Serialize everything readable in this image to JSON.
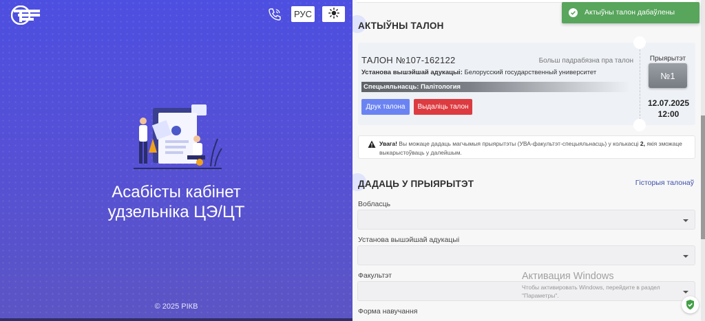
{
  "left_panel": {
    "title_line1": "Асабісты кабінет",
    "title_line2": "удзельніка ЦЭ/ЦТ",
    "copyright": "© 2025 РІКВ",
    "lang_button": "РУС",
    "icons": [
      "logo-icon",
      "phone-icon",
      "sun-icon"
    ]
  },
  "toast": {
    "message": "Актыўны талон дабаўлены",
    "color": "#58a55c"
  },
  "active_ticket": {
    "section_title": "АКТЫЎНЫ ТАЛОН",
    "number": "ТАЛОН №107-162122",
    "more_link": "Больш падрабязна пра талон",
    "institution_label": "Установа вышэйшай адукацыі:",
    "institution_value": "Белорусский государственный университет",
    "specialty": "Спецыяльнасць: Палітология",
    "print_button": "Друк талона",
    "delete_button": "Выдаліць талон",
    "priority_label": "Прыярытэт",
    "priority_value": "№1",
    "date": "12.07.2025",
    "time": "12:00"
  },
  "warning": {
    "bold": "Увага!",
    "text": "Вы можаце дадаць магчымыя прыярытэты (УВА-факультэт-спецыяльнасць) у колькасці",
    "count": "2,",
    "text2": "якія зможаце выкарыстоўваць у далейшым."
  },
  "add_priority": {
    "section_title": "ДАДАЦЬ У ПРЫЯРЫТЭТ",
    "history_link": "Гісторыя талонаў",
    "fields": [
      {
        "label": "Вобласць",
        "value": ""
      },
      {
        "label": "Установа вышэйшай адукацыі",
        "value": ""
      },
      {
        "label": "Факультэт",
        "value": ""
      },
      {
        "label": "Форма навучання",
        "value": ""
      }
    ]
  },
  "windows_watermark": {
    "title": "Активация Windows",
    "subtitle": "Чтобы активировать Windows, перейдите в раздел \"Параметры\"."
  },
  "colors": {
    "left_gradient_top": "#4d4fe0",
    "left_gradient_bottom": "#5b55c4",
    "print_button": "#6b83f2",
    "delete_button": "#dc3b40",
    "link": "#3d4fa8"
  }
}
